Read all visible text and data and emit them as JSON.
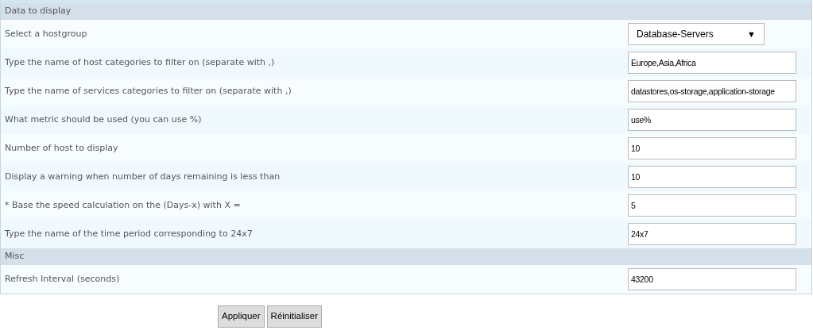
{
  "sections": [
    {
      "title": "Data to display",
      "rows": [
        {
          "kind": "select",
          "label": "Select a hostgroup",
          "value": "Database-Servers",
          "arrow": "▼"
        },
        {
          "kind": "text",
          "label": "Type the name of host categories to filter on (separate with ,)",
          "value": "Europe,Asia,Africa"
        },
        {
          "kind": "text",
          "label": "Type the name of services categories to filter on (separate with ,)",
          "value": "datastores,os-storage,application-storage"
        },
        {
          "kind": "text",
          "label": "What metric should be used (you can use %)",
          "value": "use%"
        },
        {
          "kind": "text",
          "label": "Number of host to display",
          "value": "10"
        },
        {
          "kind": "text",
          "label": "Display a warning when number of days remaining is less than",
          "value": "10"
        },
        {
          "kind": "text",
          "label": "* Base the speed calculation on the (Days-x) with X =",
          "value": "5"
        },
        {
          "kind": "text",
          "label": "Type the name of the time period corresponding to 24x7",
          "value": "24x7"
        }
      ]
    },
    {
      "title": "Misc",
      "rows": [
        {
          "kind": "text",
          "label": "Refresh Interval (seconds)",
          "value": "43200"
        }
      ]
    }
  ],
  "buttons": [
    "Appliquer",
    "Réinitialiser"
  ]
}
